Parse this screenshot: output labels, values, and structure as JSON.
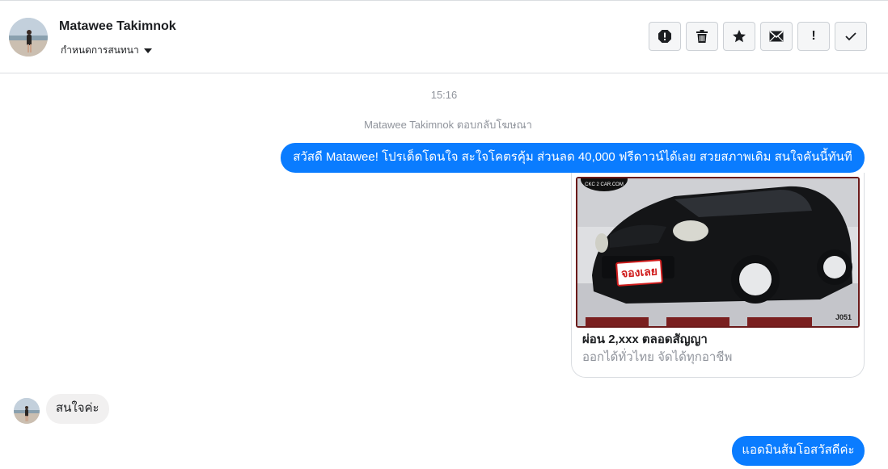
{
  "header": {
    "contact_name": "Matawee Takimnok",
    "settings_label": "กำหนดการสนทนา",
    "actions": [
      {
        "name": "report-icon"
      },
      {
        "name": "trash-icon"
      },
      {
        "name": "star-icon"
      },
      {
        "name": "envelope-icon"
      },
      {
        "name": "exclamation-icon"
      },
      {
        "name": "checkmark-icon"
      }
    ]
  },
  "conversation": {
    "timestamp": "15:16",
    "system_note": "Matawee Takimnok ตอบกลับโฆษณา",
    "messages": [
      {
        "direction": "out",
        "text": "สวัสดี Matawee! โปรเด็ดโดนใจ สะใจโคตรคุ้ม ส่วนลด 40,000 ฟรีดาวน์ได้เลย สวยสภาพเดิม สนใจคันนี้ทันที"
      },
      {
        "direction": "in",
        "text": "สนใจค่ะ"
      },
      {
        "direction": "out",
        "text": "แอดมินส้มโอสวัสดีค่ะ"
      }
    ],
    "ad_card": {
      "title": "ผ่อน 2,xxx ตลอดสัญญา",
      "subtitle": "ออกได้ทั่วไทย จัดได้ทุกอาชีพ",
      "image_badge": "จองเลย",
      "image_code": "J051",
      "image_logo": "CKC 2 CAR.COM"
    }
  },
  "colors": {
    "outgoing_bubble": "#0a7cff",
    "incoming_bubble": "#f1f0f0",
    "meta_text": "#90949c"
  }
}
